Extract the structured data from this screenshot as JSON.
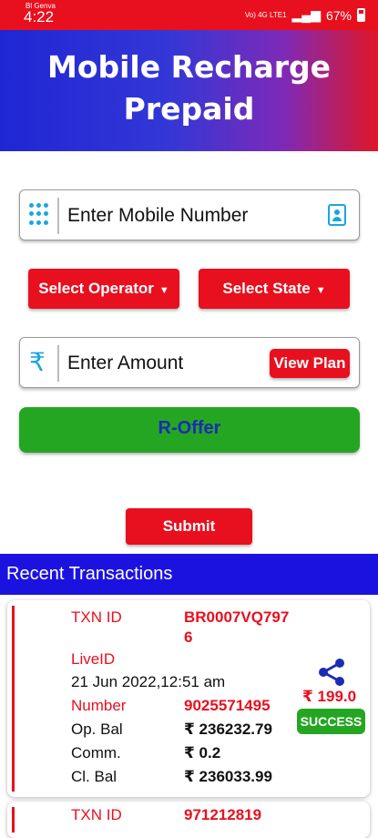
{
  "status_bar": {
    "carrier": "Bl Genva",
    "time": "4:22",
    "network_small": "Vo) 4G LTE1",
    "battery": "67%"
  },
  "header": {
    "title_line1": "Mobile Recharge",
    "title_line2": "Prepaid"
  },
  "form": {
    "mobile_placeholder": "Enter Mobile Number",
    "select_operator": "Select Operator",
    "select_state": "Select State",
    "amount_placeholder": "Enter Amount",
    "view_plan": "View Plan",
    "roffer": "R-Offer",
    "submit": "Submit"
  },
  "recent": {
    "title": "Recent Transactions",
    "transactions": [
      {
        "txn_id_label": "TXN ID",
        "txn_id_line1": "BR0007VQ797",
        "txn_id_line2": "6",
        "liveid_label": "LiveID",
        "datetime": "21 Jun 2022,12:51 am",
        "number_label": "Number",
        "number": "9025571495",
        "op_bal_label": "Op. Bal",
        "op_bal": "₹ 236232.79",
        "comm_label": "Comm.",
        "comm": "₹ 0.2",
        "cl_bal_label": "Cl. Bal",
        "cl_bal": "₹ 236033.99",
        "amount": "₹ 199.0",
        "status": "SUCCESS"
      },
      {
        "txn_id_label": "TXN ID",
        "txn_id_line1": "971212819"
      }
    ]
  },
  "colors": {
    "accent_red": "#e8101e",
    "header_blue": "#1f26d4",
    "recent_blue": "#1c12e0",
    "success_green": "#25a623",
    "icon_blue": "#19a6e0"
  }
}
